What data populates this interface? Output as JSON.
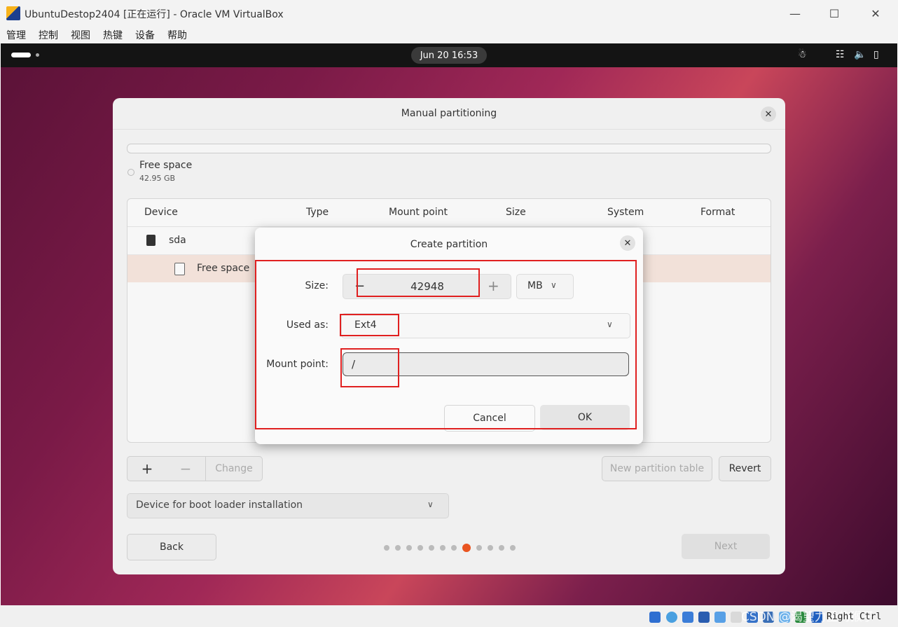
{
  "host": {
    "title": "UbuntuDestop2404 [正在运行] - Oracle VM VirtualBox",
    "menu": [
      "管理",
      "控制",
      "视图",
      "热键",
      "设备",
      "帮助"
    ],
    "status": {
      "host_key": "Right Ctrl",
      "watermark": "CSDN @渴望力量的猴子"
    }
  },
  "guest": {
    "clock": "Jun 20  16:53"
  },
  "installer": {
    "title": "Manual partitioning",
    "legend": {
      "label": "Free space",
      "size": "42.95 GB"
    },
    "table": {
      "headers": [
        "Device",
        "Type",
        "Mount point",
        "Size",
        "System",
        "Format"
      ],
      "rows": [
        {
          "device": "sda"
        },
        {
          "device": "Free space"
        }
      ]
    },
    "toolbar": {
      "add": "+",
      "remove": "−",
      "change": "Change",
      "new_table": "New partition table",
      "revert": "Revert"
    },
    "bootloader": "Device for boot loader installation",
    "back": "Back",
    "next": "Next",
    "pager": {
      "total": 12,
      "current": 8
    }
  },
  "dialog": {
    "title": "Create partition",
    "size_label": "Size:",
    "size_value": "42948",
    "size_minus": "−",
    "size_plus": "+",
    "unit": "MB",
    "used_as_label": "Used as:",
    "used_as_value": "Ext4",
    "mount_label": "Mount point:",
    "mount_value": "/",
    "cancel": "Cancel",
    "ok": "OK"
  },
  "colors": {
    "accent": "#e95420",
    "annotation": "#e02020"
  }
}
